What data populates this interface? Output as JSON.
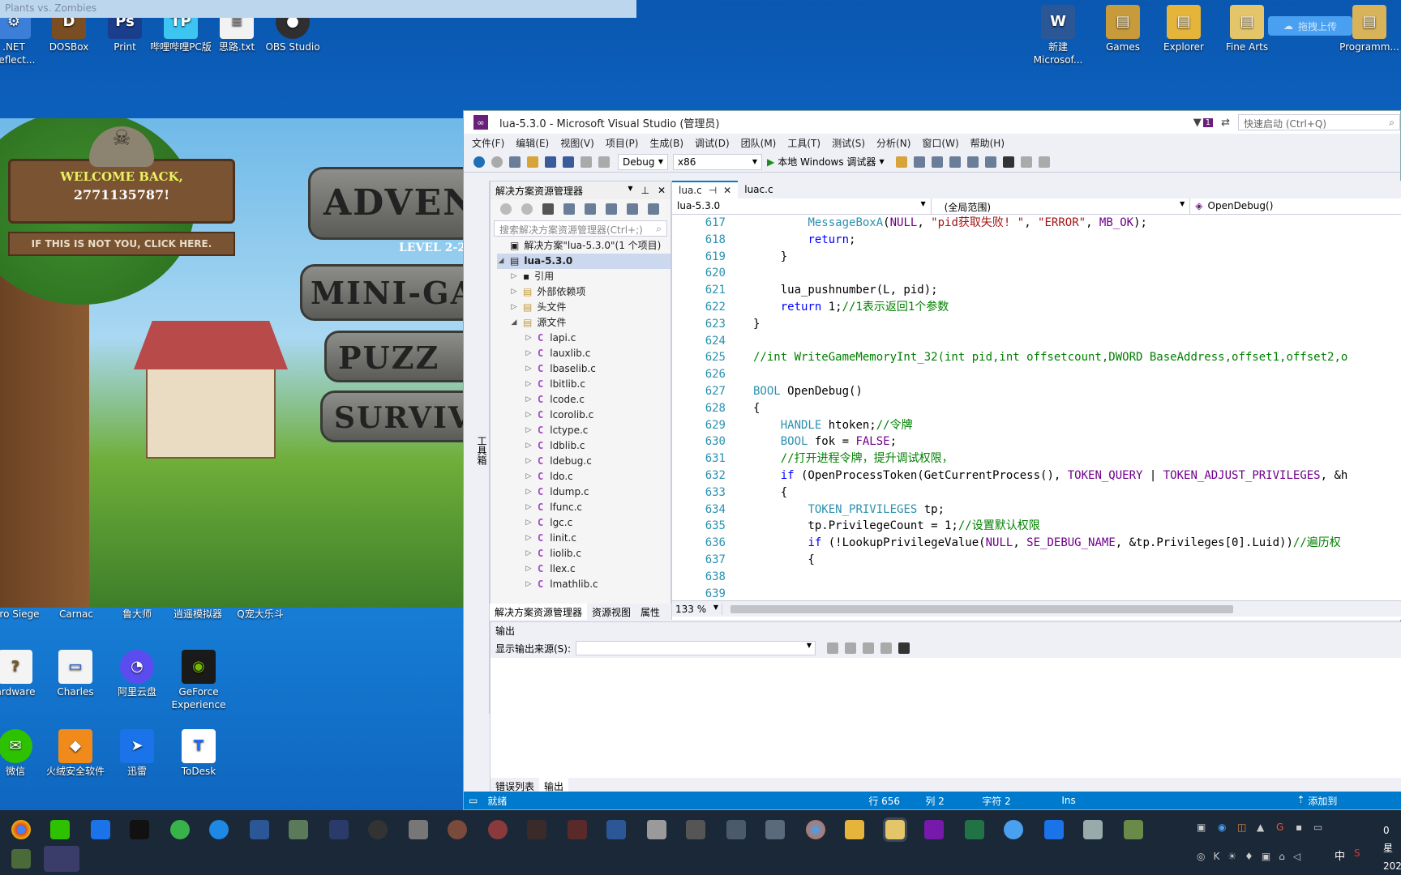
{
  "desktop_icons": [
    {
      "label": ".NET\nReflect...",
      "color": "#3b7fd8"
    },
    {
      "label": "DOSBox",
      "color": "#7a4e22"
    },
    {
      "label": "Print",
      "color": "#1a3e8c",
      "glyph": "Ps"
    },
    {
      "label": "哔哩哔哩PC版",
      "color": "#3dc4f0",
      "glyph": "TP"
    },
    {
      "label": "思路.txt",
      "color": "#f2f2f2"
    },
    {
      "label": "OBS Studio",
      "color": "#302e31"
    },
    {
      "label": "新建\nMicrosof...",
      "color": "#2b5797",
      "glyph": "W"
    },
    {
      "label": "Games",
      "color": "#c79a3a"
    },
    {
      "label": "Explorer",
      "color": "#e5b43a"
    },
    {
      "label": "Fine Arts",
      "color": "#e5c56a"
    },
    {
      "label": "Programm...",
      "color": "#d8b35a"
    },
    {
      "label": "ro Siege",
      "color": "#0000"
    },
    {
      "label": "Carnac",
      "color": "#0000"
    },
    {
      "label": "鲁大师",
      "color": "#0000"
    },
    {
      "label": "逍遥模拟器",
      "color": "#0000"
    },
    {
      "label": "Q宠大乐斗",
      "color": "#0000"
    },
    {
      "label": "ardware",
      "color": "#f4f4f4"
    },
    {
      "label": "Charles",
      "color": "#f4f4f4"
    },
    {
      "label": "阿里云盘",
      "color": "#5b4cf0"
    },
    {
      "label": "GeForce\nExperience",
      "color": "#76b900"
    },
    {
      "label": "微信",
      "color": "#2dc100"
    },
    {
      "label": "火绒安全软件",
      "color": "#f08a1b"
    },
    {
      "label": "迅雷",
      "color": "#1a73e8"
    },
    {
      "label": "ToDesk",
      "color": "#1e6fff",
      "glyph": "T"
    }
  ],
  "upload_button": "拖拽上传",
  "pvz": {
    "title": "Plants vs. Zombies",
    "welcome": "WELCOME BACK,",
    "user": "2771135787!",
    "not_you": "IF THIS IS NOT YOU, CLICK HERE.",
    "adventure": "ADVENT",
    "level": "LEVEL 2-2",
    "minigames": "MINI-GA",
    "puzzle": "PUZZ",
    "survival": "SURVIV"
  },
  "vs": {
    "title": "lua-5.3.0 - Microsoft Visual Studio (管理员)",
    "quick_launch": "快速启动 (Ctrl+Q)",
    "notif_count": "1",
    "menu": [
      "文件(F)",
      "编辑(E)",
      "视图(V)",
      "项目(P)",
      "生成(B)",
      "调试(D)",
      "团队(M)",
      "工具(T)",
      "测试(S)",
      "分析(N)",
      "窗口(W)",
      "帮助(H)"
    ],
    "config": "Debug",
    "platform": "x86",
    "run_label": "本地 Windows 调试器",
    "toolbox_strip": "工具箱",
    "solution_explorer": {
      "title": "解决方案资源管理器",
      "search_placeholder": "搜索解决方案资源管理器(Ctrl+;)",
      "solution": "解决方案\"lua-5.3.0\"(1 个项目)",
      "project": "lua-5.3.0",
      "folders": [
        "引用",
        "外部依赖项",
        "头文件",
        "源文件"
      ],
      "files": [
        "lapi.c",
        "lauxlib.c",
        "lbaselib.c",
        "lbitlib.c",
        "lcode.c",
        "lcorolib.c",
        "lctype.c",
        "ldblib.c",
        "ldebug.c",
        "ldo.c",
        "ldump.c",
        "lfunc.c",
        "lgc.c",
        "linit.c",
        "liolib.c",
        "llex.c",
        "lmathlib.c"
      ],
      "tabs": [
        "解决方案资源管理器",
        "资源视图",
        "属性"
      ]
    },
    "tabs": [
      "lua.c",
      "luac.c"
    ],
    "nav": {
      "project": "lua-5.3.0",
      "scope": "(全局范围)",
      "func": "OpenDebug()"
    },
    "code_lines": [
      {
        "n": "617",
        "html": "        <span class='ty'>MessageBoxA</span>(<span class='mac'>NULL</span>, <span class='st'>\"pid获取失败! \"</span>, <span class='st'>\"ERROR\"</span>, <span class='mac'>MB_OK</span>);"
      },
      {
        "n": "618",
        "html": "        <span class='kw'>return</span>;"
      },
      {
        "n": "619",
        "html": "    }"
      },
      {
        "n": "620",
        "html": ""
      },
      {
        "n": "621",
        "html": "    lua_pushnumber(L, pid);"
      },
      {
        "n": "622",
        "html": "    <span class='kw'>return</span> 1;<span class='cm'>//1表示返回1个参数</span>"
      },
      {
        "n": "623",
        "html": "}"
      },
      {
        "n": "624",
        "html": ""
      },
      {
        "n": "625",
        "html": "<span class='cm'>//int WriteGameMemoryInt_32(int pid,int offsetcount,DWORD BaseAddress,offset1,offset2,o</span>"
      },
      {
        "n": "626",
        "html": ""
      },
      {
        "n": "627",
        "html": "<span class='ty'>BOOL</span> OpenDebug()"
      },
      {
        "n": "628",
        "html": "{"
      },
      {
        "n": "629",
        "html": "    <span class='ty'>HANDLE</span> htoken;<span class='cm'>//令牌</span>"
      },
      {
        "n": "630",
        "html": "    <span class='ty'>BOOL</span> fok = <span class='mac'>FALSE</span>;"
      },
      {
        "n": "631",
        "html": "    <span class='cm'>//打开进程令牌，提升调试权限，</span>"
      },
      {
        "n": "632",
        "html": "    <span class='kw'>if</span> (OpenProcessToken(GetCurrentProcess(), <span class='mac'>TOKEN_QUERY</span> | <span class='mac'>TOKEN_ADJUST_PRIVILEGES</span>, &amp;h"
      },
      {
        "n": "633",
        "html": "    {"
      },
      {
        "n": "634",
        "html": "        <span class='ty'>TOKEN_PRIVILEGES</span> tp;"
      },
      {
        "n": "635",
        "html": "        tp.PrivilegeCount = 1;<span class='cm'>//设置默认权限</span>"
      },
      {
        "n": "636",
        "html": "        <span class='kw'>if</span> (!LookupPrivilegeValue(<span class='mac'>NULL</span>, <span class='mac'>SE_DEBUG_NAME</span>, &amp;tp.Privileges[0].Luid))<span class='cm'>//遍历权</span>"
      },
      {
        "n": "637",
        "html": "        {"
      },
      {
        "n": "638",
        "html": ""
      },
      {
        "n": "639",
        "html": ""
      }
    ],
    "zoom": "133 %",
    "output": {
      "title": "输出",
      "source_label": "显示输出来源(S):",
      "tabs": [
        "错误列表",
        "输出"
      ]
    },
    "status": {
      "ready": "就绪",
      "line": "行 656",
      "col": "列 2",
      "char": "字符 2",
      "ins": "Ins",
      "addsrc": "添加到"
    }
  },
  "tray": {
    "ime": "中",
    "time": "0",
    "date": "202",
    "day": "星"
  }
}
